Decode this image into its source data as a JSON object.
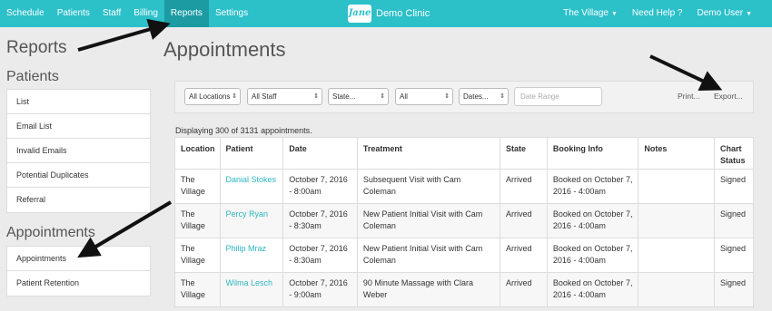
{
  "nav": {
    "items": [
      "Schedule",
      "Patients",
      "Staff",
      "Billing",
      "Reports",
      "Settings"
    ],
    "active": "Reports",
    "brand_logo": "Jane",
    "brand_name": "Demo Clinic",
    "location_menu": "The Village",
    "help": "Need Help ?",
    "user_menu": "Demo User"
  },
  "sidebar": {
    "title": "Reports",
    "patients_heading": "Patients",
    "patients_items": [
      "List",
      "Email List",
      "Invalid Emails",
      "Potential Duplicates",
      "Referral"
    ],
    "appointments_heading": "Appointments",
    "appointments_items": [
      "Appointments",
      "Patient Retention"
    ]
  },
  "main": {
    "title": "Appointments",
    "filters": {
      "location": "All Locations",
      "staff": "All Staff",
      "state": "State...",
      "all": "All",
      "dates": "Dates...",
      "date_range_placeholder": "Date Range"
    },
    "print": "Print...",
    "export": "Export...",
    "count_text": "Displaying 300 of 3131 appointments."
  },
  "table": {
    "headers": [
      "Location",
      "Patient",
      "Date",
      "Treatment",
      "State",
      "Booking Info",
      "Notes",
      "Chart Status"
    ],
    "rows": [
      {
        "location": "The Village",
        "patient": "Danial Stokes",
        "date": "October 7, 2016 - 8:00am",
        "treatment": "Subsequent Visit with Cam Coleman",
        "state": "Arrived",
        "booking": "Booked on October 7, 2016 - 4:00am",
        "notes": "",
        "chart": "Signed"
      },
      {
        "location": "The Village",
        "patient": "Percy Ryan",
        "date": "October 7, 2016 - 8:30am",
        "treatment": "New Patient Initial Visit with Cam Coleman",
        "state": "Arrived",
        "booking": "Booked on October 7, 2016 - 4:00am",
        "notes": "",
        "chart": "Signed"
      },
      {
        "location": "The Village",
        "patient": "Philip Mraz",
        "date": "October 7, 2016 - 8:30am",
        "treatment": "New Patient Initial Visit with Cam Coleman",
        "state": "Arrived",
        "booking": "Booked on October 7, 2016 - 4:00am",
        "notes": "",
        "chart": "Signed"
      },
      {
        "location": "The Village",
        "patient": "Wilma Lesch",
        "date": "October 7, 2016 - 9:00am",
        "treatment": "90 Minute Massage with Clara Weber",
        "state": "Arrived",
        "booking": "Booked on October 7, 2016 - 4:00am",
        "notes": "",
        "chart": "Signed"
      }
    ]
  },
  "colors": {
    "accent": "#2cc0c9",
    "active_nav": "#1c9ba3",
    "link": "#2cb6c0"
  }
}
